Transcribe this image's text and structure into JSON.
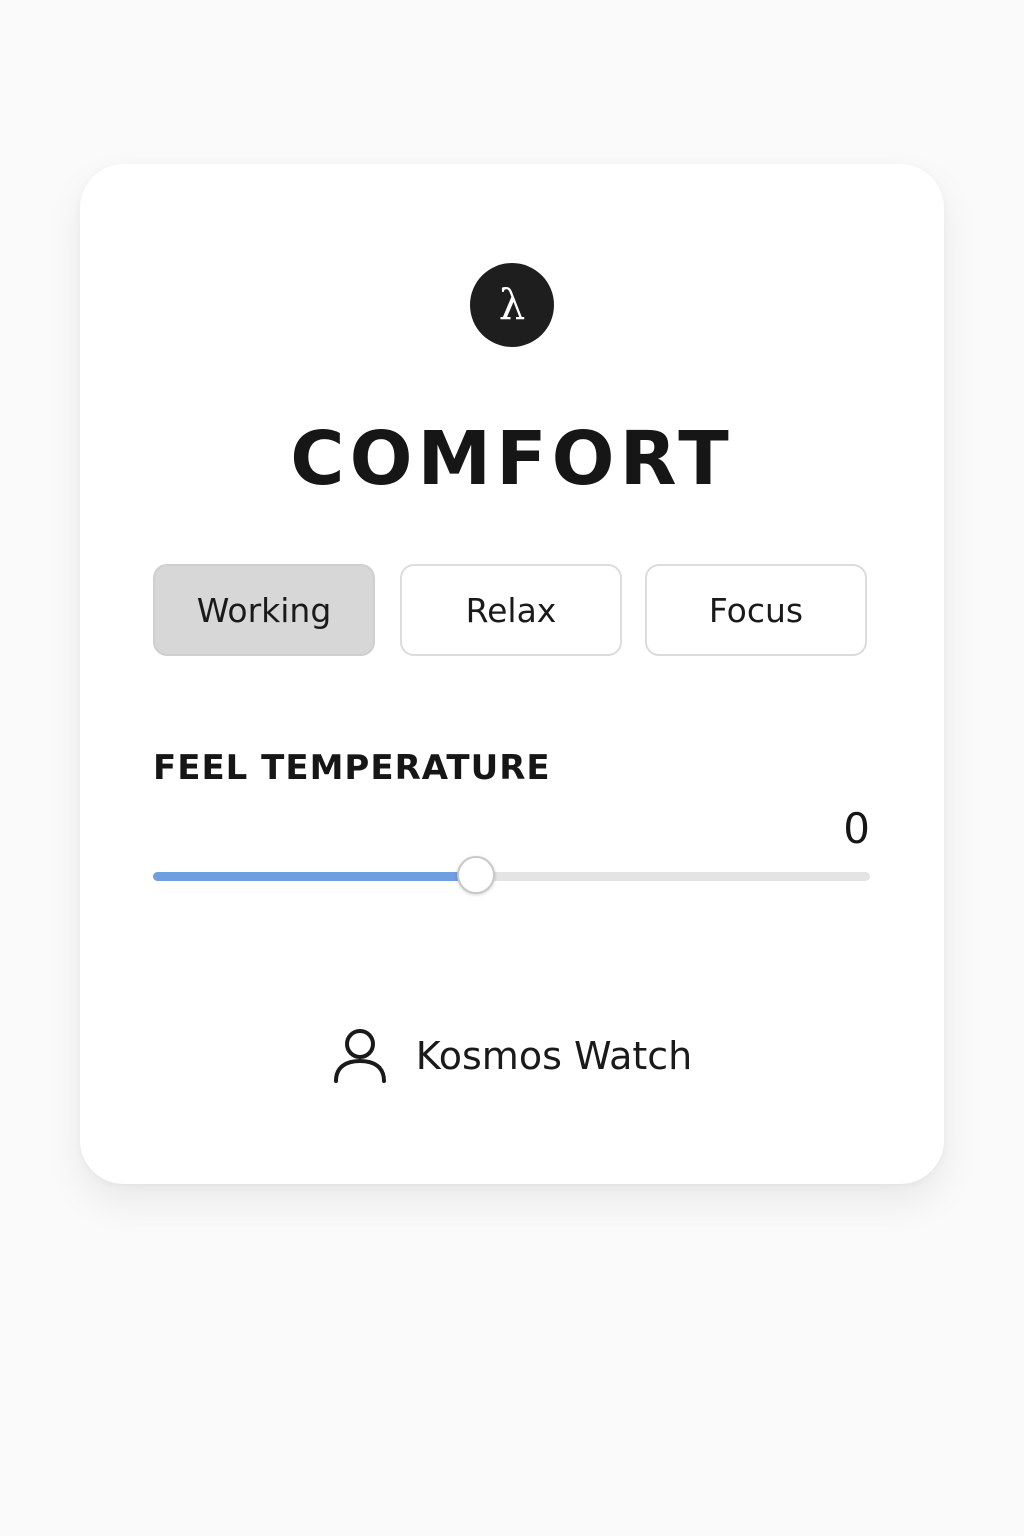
{
  "app": {
    "logo_glyph": "λ",
    "title": "COMFORT"
  },
  "modes": {
    "selected": "Working",
    "items": [
      {
        "label": "Working"
      },
      {
        "label": "Relax"
      },
      {
        "label": "Focus"
      }
    ]
  },
  "feel_temperature": {
    "label": "FEEL TEMPERATURE",
    "value": "0",
    "slider_fraction": 0.45
  },
  "user": {
    "icon": "user-icon",
    "name": "Kosmos Watch"
  },
  "colors": {
    "accent": "#6f9fe0",
    "selected_mode_bg": "#d7d7d7",
    "logo_bg": "#1e1e1e"
  }
}
